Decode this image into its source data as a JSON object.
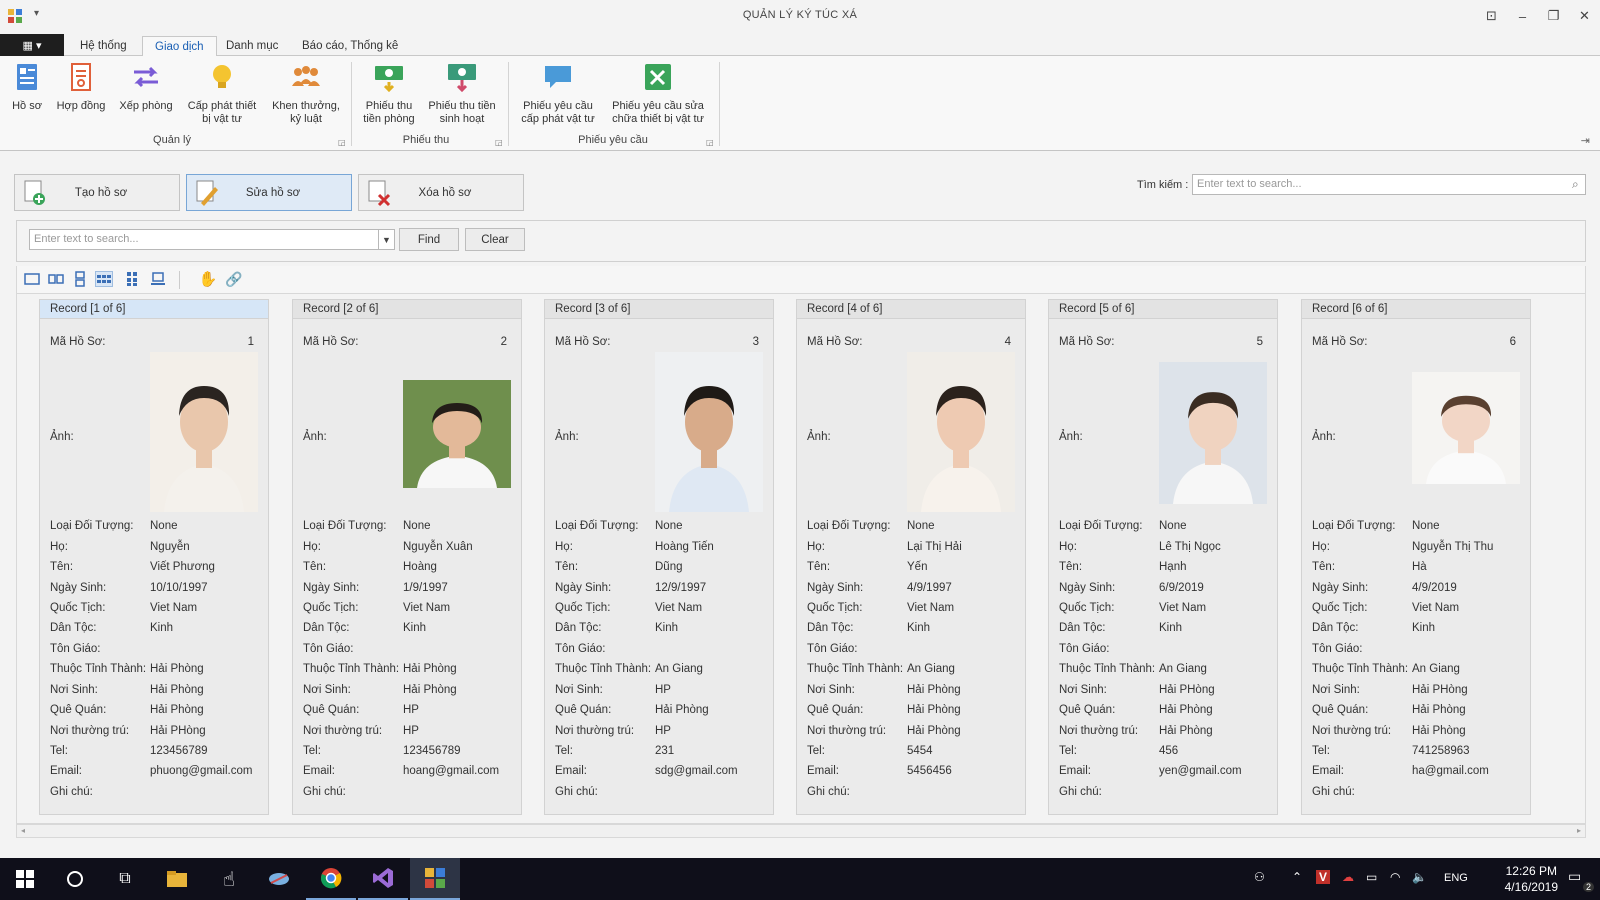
{
  "window": {
    "title": "QUẢN LÝ KÝ TÚC XÁ",
    "quick_access": "▾",
    "controls": [
      "⊡",
      "–",
      "❐",
      "✕"
    ]
  },
  "ribbon": {
    "file_label": "▦ ▾",
    "tabs": [
      "Hệ thống",
      "Giao dịch",
      "Danh mục",
      "Báo cáo, Thống kê"
    ],
    "active_tab": "Giao dịch",
    "buttons": [
      {
        "label": "Hồ sơ",
        "icon": "profile-icon"
      },
      {
        "label": "Hợp đồng",
        "icon": "contract-icon"
      },
      {
        "label": "Xếp phòng",
        "icon": "arrange-room-icon"
      },
      {
        "label": "Cấp phát thiết bị vật tư",
        "icon": "lightbulb-icon"
      },
      {
        "label": "Khen thưởng, kỷ luật",
        "icon": "people-icon"
      },
      {
        "label": "Phiếu thu tiền phòng",
        "icon": "money-icon"
      },
      {
        "label": "Phiếu thu tiền sinh hoạt",
        "icon": "money-down-icon"
      },
      {
        "label": "Phiếu yêu cầu cấp phát vật tư",
        "icon": "request-icon"
      },
      {
        "label": "Phiếu yêu cầu sửa chữa thiết bị vật tư",
        "icon": "repair-icon"
      }
    ],
    "groups": [
      "Quản lý",
      "Phiếu thu",
      "Phiếu yêu cầu"
    ]
  },
  "actions": {
    "create": "Tạo hồ sơ",
    "edit": "Sửa hồ sơ",
    "delete": "Xóa hồ sơ"
  },
  "search": {
    "label": "Tìm kiếm :",
    "placeholder": "Enter text to search..."
  },
  "find_panel": {
    "placeholder": "Enter text to search...",
    "find_label": "Find",
    "clear_label": "Clear"
  },
  "field_labels": {
    "id": "Mã Hồ Sơ:",
    "photo": "Ảnh:",
    "type": "Loại Đối Tượng:",
    "last": "Họ:",
    "first": "Tên:",
    "dob": "Ngày Sinh:",
    "nationality": "Quốc Tịch:",
    "ethnicity": "Dân Tộc:",
    "religion": "Tôn Giáo:",
    "province": "Thuộc Tỉnh Thành:",
    "birthplace": "Nơi Sinh:",
    "hometown": "Quê Quán:",
    "residence": "Nơi thường trú:",
    "tel": "Tel:",
    "email": "Email:",
    "note": "Ghi chú:"
  },
  "records": [
    {
      "header": "Record [1 of 6]",
      "id": "1",
      "type": "None",
      "last": "Nguyễn",
      "first": "Viết Phương",
      "dob": "10/10/1997",
      "nationality": "Viet Nam",
      "ethnicity": "Kinh",
      "religion": "",
      "province": "Hải Phòng",
      "birthplace": "Hải Phòng",
      "hometown": "Hải Phòng",
      "residence": "Hải PHòng",
      "tel": "123456789",
      "email": "phuong@gmail.com",
      "note": ""
    },
    {
      "header": "Record [2 of 6]",
      "id": "2",
      "type": "None",
      "last": "Nguyễn Xuân",
      "first": "Hoàng",
      "dob": "1/9/1997",
      "nationality": "Viet Nam",
      "ethnicity": "Kinh",
      "religion": "",
      "province": "Hải Phòng",
      "birthplace": "Hải Phòng",
      "hometown": "HP",
      "residence": "HP",
      "tel": "123456789",
      "email": "hoang@gmail.com",
      "note": ""
    },
    {
      "header": "Record [3 of 6]",
      "id": "3",
      "type": "None",
      "last": "Hoàng Tiến",
      "first": "Dũng",
      "dob": "12/9/1997",
      "nationality": "Viet Nam",
      "ethnicity": "Kinh",
      "religion": "",
      "province": "An Giang",
      "birthplace": "HP",
      "hometown": "Hải Phòng",
      "residence": "HP",
      "tel": "231",
      "email": "sdg@gmail.com",
      "note": ""
    },
    {
      "header": "Record [4 of 6]",
      "id": "4",
      "type": "None",
      "last": "Lại Thị Hải",
      "first": "Yến",
      "dob": "4/9/1997",
      "nationality": "Viet Nam",
      "ethnicity": "Kinh",
      "religion": "",
      "province": "An Giang",
      "birthplace": "Hải Phòng",
      "hometown": "Hải Phòng",
      "residence": "Hải Phòng",
      "tel": "5454",
      "email": "5456456",
      "note": ""
    },
    {
      "header": "Record [5 of 6]",
      "id": "5",
      "type": "None",
      "last": "Lê Thị Ngọc",
      "first": "Hạnh",
      "dob": "6/9/2019",
      "nationality": "Viet Nam",
      "ethnicity": "Kinh",
      "religion": "",
      "province": "An Giang",
      "birthplace": "Hải PHòng",
      "hometown": "Hải Phòng",
      "residence": "Hải Phòng",
      "tel": "456",
      "email": "yen@gmail.com",
      "note": ""
    },
    {
      "header": "Record [6 of 6]",
      "id": "6",
      "type": "None",
      "last": "Nguyễn Thị Thu",
      "first": "Hà",
      "dob": "4/9/2019",
      "nationality": "Viet Nam",
      "ethnicity": "Kinh",
      "religion": "",
      "province": "An Giang",
      "birthplace": "Hải PHòng",
      "hometown": "Hải Phòng",
      "residence": "Hải Phòng",
      "tel": "741258963",
      "email": "ha@gmail.com",
      "note": ""
    }
  ],
  "taskbar": {
    "lang": "ENG",
    "time": "12:26 PM",
    "date": "4/16/2019",
    "notifications": "2"
  },
  "colors": {
    "accent": "#1a5fb4",
    "taskbar": "#0f0f1a",
    "selected_record": "#d6e6f7"
  }
}
